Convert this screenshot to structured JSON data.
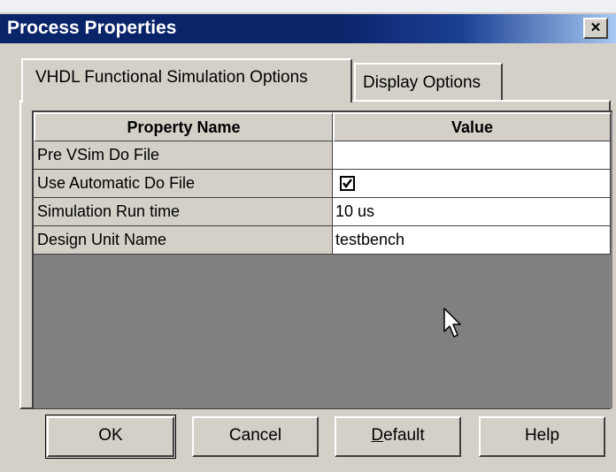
{
  "window": {
    "title": "Process Properties",
    "close_glyph": "✕"
  },
  "tabs": [
    {
      "label": "VHDL Functional Simulation Options",
      "active": true
    },
    {
      "label": "Display Options",
      "active": false
    }
  ],
  "table": {
    "columns": [
      "Property Name",
      "Value"
    ],
    "rows": [
      {
        "name": "Pre VSim Do File",
        "value": ""
      },
      {
        "name": "Use Automatic Do File",
        "value": "checked",
        "type": "checkbox"
      },
      {
        "name": "Simulation Run time",
        "value": "10 us"
      },
      {
        "name": "Design Unit Name",
        "value": "testbench"
      }
    ]
  },
  "buttons": {
    "ok": "OK",
    "cancel": "Cancel",
    "default_first": "D",
    "default_rest": "efault",
    "help": "Help"
  },
  "colors": {
    "titlebar": "#0a246a",
    "face": "#d4d0c8",
    "grid_empty": "#808080"
  },
  "icons": {
    "cursor": "arrow-cursor-icon",
    "close": "close-icon",
    "check": "checkmark-icon"
  }
}
